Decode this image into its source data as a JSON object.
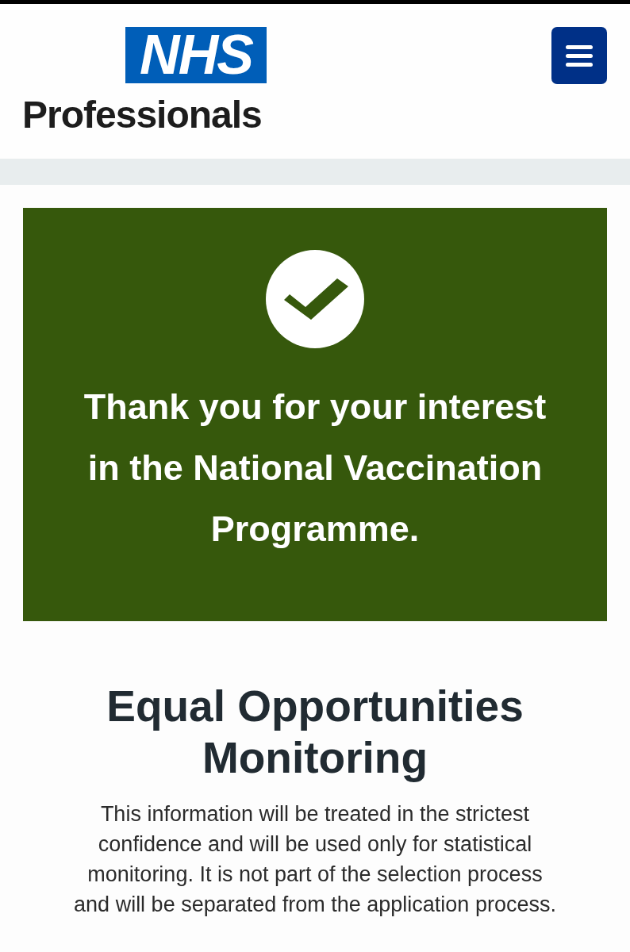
{
  "header": {
    "logo_mark": "NHS",
    "logo_name": "Professionals"
  },
  "banner": {
    "message": "Thank you for your interest in the National Vaccination Programme."
  },
  "section": {
    "title": "Equal Opportunities Monitoring",
    "body": "This information will be treated in the strictest confidence and will be used only for statistical monitoring. It is not part of the selection process and will be separated from the application process."
  }
}
